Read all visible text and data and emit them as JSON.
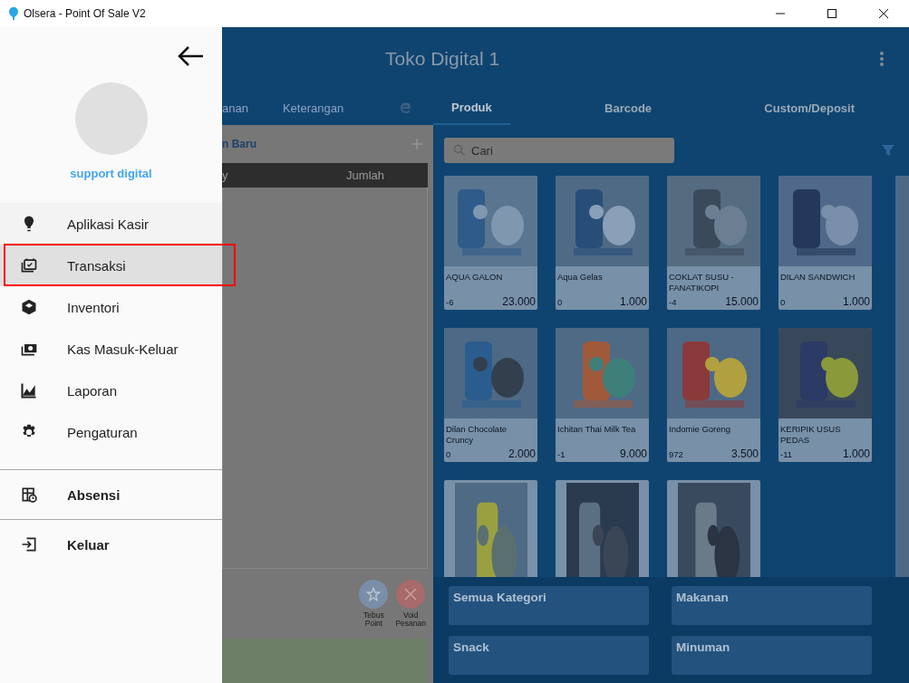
{
  "window": {
    "title": "Olsera - Point Of Sale V2"
  },
  "drawer": {
    "user_name": "support digital",
    "menu": [
      {
        "label": "Aplikasi Kasir",
        "selected": true,
        "hovered": false,
        "outlined": false
      },
      {
        "label": "Transaksi",
        "selected": false,
        "hovered": true,
        "outlined": true
      },
      {
        "label": "Inventori",
        "selected": false,
        "hovered": false,
        "outlined": false
      },
      {
        "label": "Kas Masuk-Keluar",
        "selected": false,
        "hovered": false,
        "outlined": false
      },
      {
        "label": "Laporan",
        "selected": false,
        "hovered": false,
        "outlined": false
      },
      {
        "label": "Pengaturan",
        "selected": false,
        "hovered": false,
        "outlined": false
      }
    ],
    "footer_items": [
      {
        "label": "Absensi"
      },
      {
        "label": "Keluar"
      }
    ]
  },
  "app": {
    "title": "Toko Digital 1",
    "order_tabs": [
      "anan",
      "Keterangan"
    ],
    "product_tabs": [
      {
        "label": "Produk",
        "selected": true
      },
      {
        "label": "Barcode",
        "selected": false
      },
      {
        "label": "Custom/Deposit",
        "selected": false
      }
    ],
    "order_panel": {
      "title": "n Baru",
      "columns": [
        "y",
        "Jumlah"
      ],
      "actions": [
        {
          "label": "Tebus Point",
          "kind": "star"
        },
        {
          "label": "Void Pesanan",
          "kind": "void"
        }
      ]
    },
    "search": {
      "placeholder": "Cari"
    },
    "products": [
      {
        "name": "AQUA GALON",
        "stock": "-6",
        "price": "23.000"
      },
      {
        "name": "Aqua Gelas",
        "stock": "0",
        "price": "1.000"
      },
      {
        "name": "COKLAT SUSU - FANATIKOPI",
        "stock": "-4",
        "price": "15.000"
      },
      {
        "name": "DILAN SANDWICH",
        "stock": "0",
        "price": "1.000"
      },
      {
        "name": "Dilan Chocolate Cruncy",
        "stock": "0",
        "price": "2.000"
      },
      {
        "name": "Ichitan Thai Milk Tea",
        "stock": "-1",
        "price": "9.000"
      },
      {
        "name": "Indomie Goreng",
        "stock": "972",
        "price": "3.500"
      },
      {
        "name": "KERIPIK USUS PEDAS",
        "stock": "-11",
        "price": "1.000"
      },
      {
        "kind": "picture"
      },
      {
        "kind": "picture"
      },
      {
        "kind": "picture"
      }
    ],
    "categories": [
      "Semua Kategori",
      "Makanan",
      "Snack",
      "Minuman"
    ]
  }
}
